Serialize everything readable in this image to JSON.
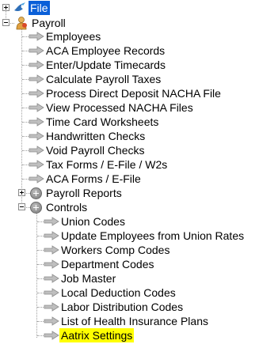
{
  "tree": {
    "root": {
      "label": "File",
      "expanded": false,
      "selected": true,
      "icon": "bird-icon"
    },
    "payroll": {
      "label": "Payroll",
      "expanded": true,
      "icon": "person-icon",
      "items": [
        {
          "label": "Employees",
          "icon": "arrow-right-icon"
        },
        {
          "label": "ACA Employee Records",
          "icon": "arrow-right-icon"
        },
        {
          "label": "Enter/Update Timecards",
          "icon": "arrow-right-icon"
        },
        {
          "label": "Calculate Payroll Taxes",
          "icon": "arrow-right-icon"
        },
        {
          "label": "Process Direct Deposit NACHA File",
          "icon": "arrow-right-icon"
        },
        {
          "label": "View Processed NACHA Files",
          "icon": "arrow-right-icon"
        },
        {
          "label": "Time Card Worksheets",
          "icon": "arrow-right-icon"
        },
        {
          "label": "Handwritten Checks",
          "icon": "arrow-right-icon"
        },
        {
          "label": "Void Payroll Checks",
          "icon": "arrow-right-icon"
        },
        {
          "label": "Tax Forms / E-File / W2s",
          "icon": "arrow-right-icon"
        },
        {
          "label": "ACA Forms / E-File",
          "icon": "arrow-right-icon"
        }
      ],
      "reports": {
        "label": "Payroll Reports",
        "expanded": false,
        "icon": "plus-circle-icon"
      },
      "controls": {
        "label": "Controls",
        "expanded": true,
        "icon": "plus-circle-icon",
        "items": [
          {
            "label": "Union Codes",
            "icon": "arrow-right-icon"
          },
          {
            "label": "Update Employees from Union Rates",
            "icon": "arrow-right-icon"
          },
          {
            "label": "Workers Comp Codes",
            "icon": "arrow-right-icon"
          },
          {
            "label": "Department Codes",
            "icon": "arrow-right-icon"
          },
          {
            "label": "Job Master",
            "icon": "arrow-right-icon"
          },
          {
            "label": "Local Deduction Codes",
            "icon": "arrow-right-icon"
          },
          {
            "label": "Labor Distribution Codes",
            "icon": "arrow-right-icon"
          },
          {
            "label": "List of Health Insurance Plans",
            "icon": "arrow-right-icon"
          },
          {
            "label": "Aatrix Settings",
            "icon": "arrow-right-icon",
            "highlighted": true
          }
        ]
      }
    },
    "colors": {
      "selection": "#0a5fd8",
      "highlight": "#ffff00",
      "arrow": "#9a9a9a"
    }
  }
}
